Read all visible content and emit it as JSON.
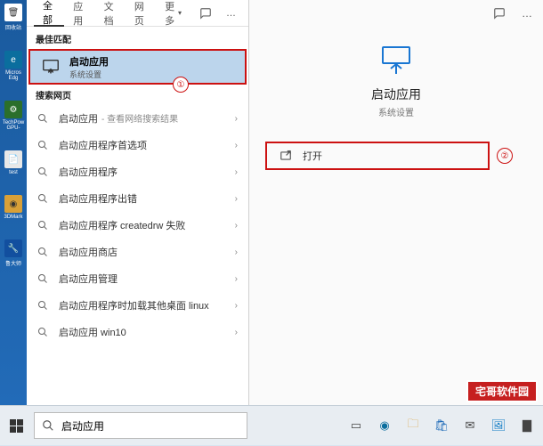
{
  "desktop": {
    "items": [
      {
        "label": "回收站"
      },
      {
        "label": "Micros Edg"
      },
      {
        "label": "TechPow GPU-"
      },
      {
        "label": "test"
      },
      {
        "label": "3DMark"
      },
      {
        "label": "鲁大师"
      }
    ]
  },
  "tabs": {
    "all": "全部",
    "apps": "应用",
    "docs": "文档",
    "web": "网页",
    "more": "更多",
    "feedback_icon": "feedback",
    "more_icon": "…"
  },
  "best_match": {
    "section_label": "最佳匹配",
    "title": "启动应用",
    "subtitle": "系统设置",
    "annotation": "①"
  },
  "web_search": {
    "section_label": "搜索网页",
    "suffix": "- 查看网络搜索结果",
    "items": [
      {
        "text": "启动应用",
        "has_suffix": true
      },
      {
        "text": "启动应用程序首选项"
      },
      {
        "text": "启动应用程序"
      },
      {
        "text": "启动应用程序出错"
      },
      {
        "text": "启动应用程序 createdrw 失败"
      },
      {
        "text": "启动应用商店"
      },
      {
        "text": "启动应用管理"
      },
      {
        "text": "启动应用程序时加载其他桌面 linux"
      },
      {
        "text": "启动应用 win10"
      }
    ]
  },
  "preview": {
    "title": "启动应用",
    "subtitle": "系统设置",
    "open_label": "打开",
    "annotation": "②"
  },
  "taskbar": {
    "search_value": "启动应用"
  },
  "watermark": "宅哥软件园"
}
